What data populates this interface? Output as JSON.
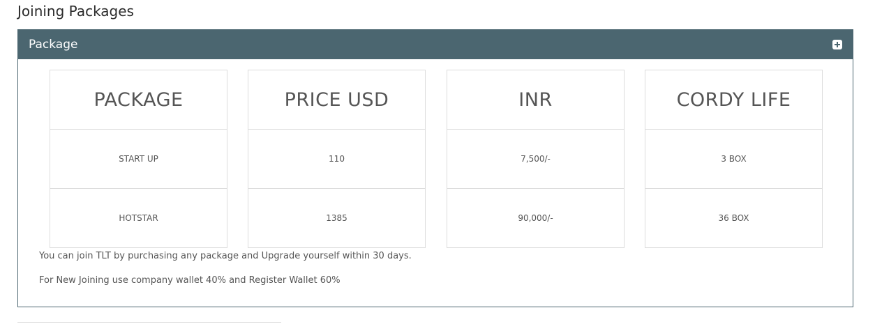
{
  "page": {
    "title": "Joining Packages"
  },
  "panel": {
    "title": "Package",
    "expand_icon": "plus-square-icon",
    "header_color": "#4b6670"
  },
  "table": {
    "columns": [
      {
        "header": "PACKAGE",
        "rows": [
          "START UP",
          "HOTSTAR"
        ]
      },
      {
        "header": "PRICE USD",
        "rows": [
          "110",
          "1385"
        ]
      },
      {
        "header": "INR",
        "rows": [
          "7,500/-",
          "90,000/-"
        ]
      },
      {
        "header": "CORDY LIFE",
        "rows": [
          "3 BOX",
          "36 BOX"
        ]
      }
    ]
  },
  "notes": {
    "line1": "You can join TLT by purchasing any package and Upgrade yourself within 30 days.",
    "line2": "For New Joining use company wallet 40% and Register Wallet 60%"
  }
}
